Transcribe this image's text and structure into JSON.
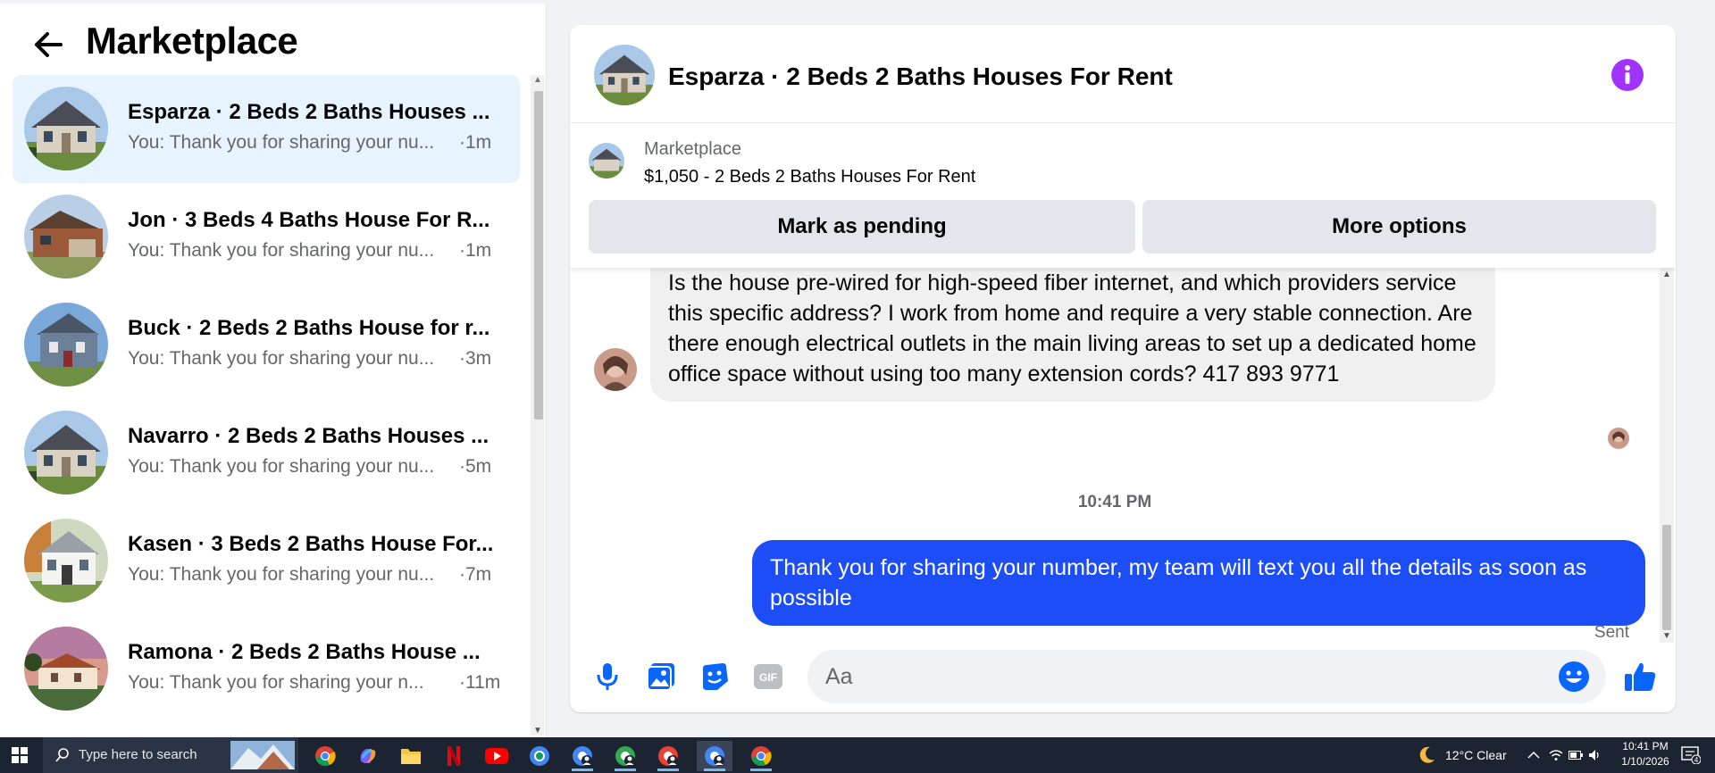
{
  "sidebar": {
    "title": "Marketplace",
    "conversations": [
      {
        "name": "Esparza · 2 Beds 2 Baths Houses ...",
        "preview": "You: Thank you for sharing your nu...",
        "time": "·1m",
        "active": true
      },
      {
        "name": "Jon · 3 Beds 4 Baths House For R...",
        "preview": "You: Thank you for sharing your nu...",
        "time": "·1m"
      },
      {
        "name": "Buck · 2 Beds 2 Baths House for r...",
        "preview": "You: Thank you for sharing your nu...",
        "time": "·3m"
      },
      {
        "name": "Navarro · 2 Beds 2 Baths Houses ...",
        "preview": "You: Thank you for sharing your nu...",
        "time": "·5m"
      },
      {
        "name": "Kasen · 3 Beds 2 Baths House For...",
        "preview": "You: Thank you for sharing your nu...",
        "time": "·7m"
      },
      {
        "name": "Ramona · 2 Beds 2 Baths House ...",
        "preview": "You: Thank you for sharing your n...",
        "time": "·11m"
      }
    ]
  },
  "chat": {
    "title": "Esparza · 2 Beds 2 Baths Houses For Rent",
    "listing": {
      "label": "Marketplace",
      "description": "$1,050 - 2 Beds 2 Baths Houses For Rent",
      "pending_button": "Mark as pending",
      "more_button": "More options"
    },
    "incoming_message": "Is the house pre-wired for high-speed fiber internet, and which providers service this specific address? I work from home and require a very stable connection. Are there enough electrical outlets in the main living areas to set up a dedicated home office space without using too many extension cords? 417 893 9771",
    "timestamp": "10:41 PM",
    "outgoing_message": "Thank you for  sharing your number, my team will text you all the details as soon as possible",
    "status": "Sent",
    "composer_placeholder": "Aa"
  },
  "taskbar": {
    "search_placeholder": "Type here to search",
    "weather": "12°C  Clear",
    "time": "10:41 PM",
    "date": "1/10/2026",
    "notification_count": "4"
  },
  "colors": {
    "accent_blue": "#1d4ef5",
    "active_row": "#e7f3ff",
    "info_purple": "#a033ff",
    "taskbar": "#1c2331"
  }
}
